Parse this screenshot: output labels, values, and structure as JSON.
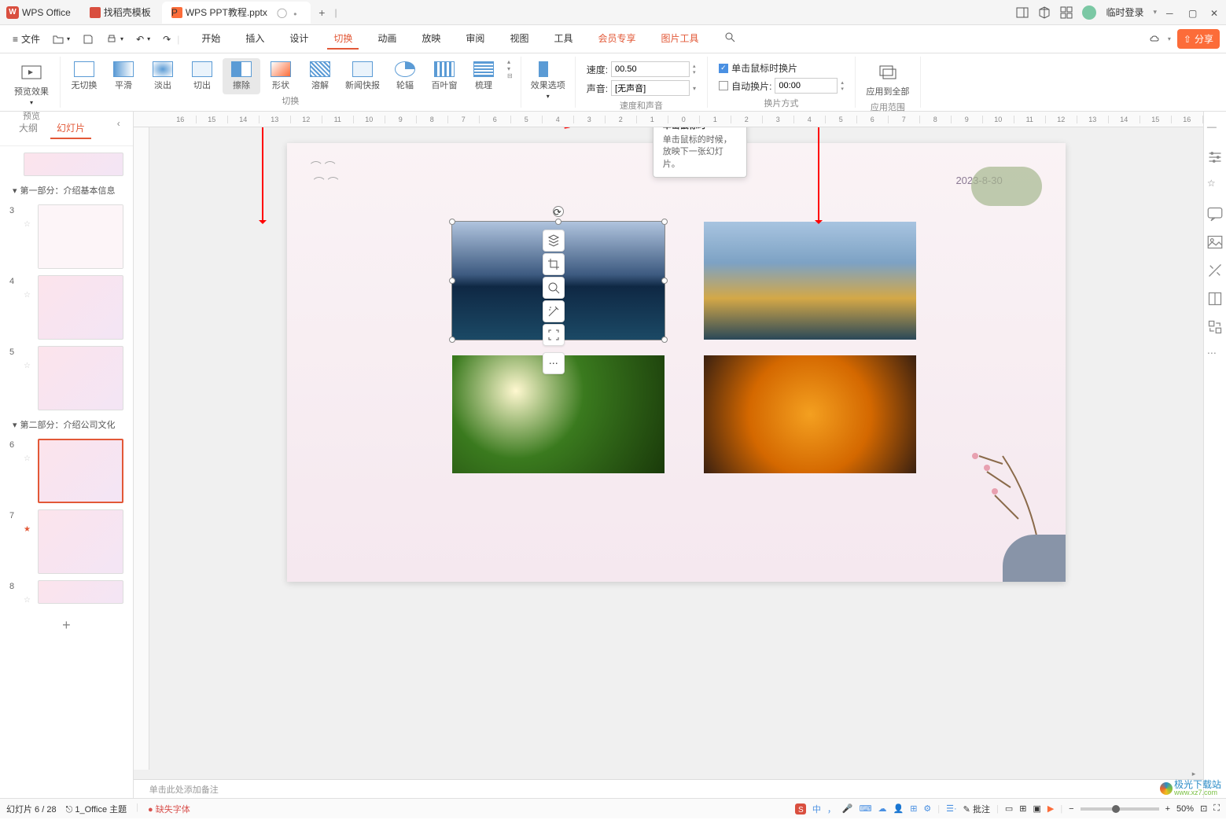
{
  "titlebar": {
    "app_name": "WPS Office",
    "tabs": [
      {
        "label": "找稻壳模板"
      },
      {
        "label": "WPS PPT教程.pptx"
      }
    ],
    "login": "临时登录"
  },
  "menubar": {
    "file": "文件",
    "items": [
      "开始",
      "插入",
      "设计",
      "切换",
      "动画",
      "放映",
      "审阅",
      "视图",
      "工具",
      "会员专享",
      "图片工具"
    ],
    "share": "分享"
  },
  "ribbon": {
    "preview_effect": "预览效果",
    "preview": "预览",
    "transitions": {
      "label": "切换",
      "items": [
        "无切换",
        "平滑",
        "淡出",
        "切出",
        "擦除",
        "形状",
        "溶解",
        "新闻快报",
        "轮辐",
        "百叶窗",
        "梳理"
      ]
    },
    "effect_options": "效果选项",
    "speed": {
      "label": "速度:",
      "value": "00.50",
      "sound_label": "声音:",
      "sound_value": "[无声音]",
      "group_label": "速度和声音"
    },
    "advance": {
      "on_click": "单击鼠标时换片",
      "auto_after": "自动换片:",
      "auto_value": "00:00",
      "group_label": "换片方式"
    },
    "apply_all": "应用到全部",
    "apply_scope": "应用范围"
  },
  "tooltip": {
    "title": "单击鼠标时",
    "body": "单击鼠标的时候，放映下一张幻灯片。"
  },
  "sidebar": {
    "outline_tab": "大纲",
    "slides_tab": "幻灯片",
    "sections": [
      {
        "name": "第一部分：介绍基本信息",
        "slides": [
          "3",
          "4",
          "5"
        ]
      },
      {
        "name": "第二部分：介绍公司文化",
        "slides": [
          "6",
          "7",
          "8"
        ]
      }
    ]
  },
  "slide": {
    "date": "2023-8-30"
  },
  "notes": {
    "placeholder": "单击此处添加备注"
  },
  "statusbar": {
    "slide_count": "幻灯片 6 / 28",
    "theme": "1_Office 主题",
    "missing_font": "缺失字体",
    "notes_btn": "批注",
    "zoom": "50%"
  },
  "watermark": {
    "name": "极光下载站",
    "url": "www.xz7.com"
  },
  "ruler": [
    "16",
    "15",
    "14",
    "13",
    "12",
    "11",
    "10",
    "9",
    "8",
    "7",
    "6",
    "5",
    "4",
    "3",
    "2",
    "1",
    "0",
    "1",
    "2",
    "3",
    "4",
    "5",
    "6",
    "7",
    "8",
    "9",
    "10",
    "11",
    "12",
    "13",
    "14",
    "15",
    "16"
  ]
}
